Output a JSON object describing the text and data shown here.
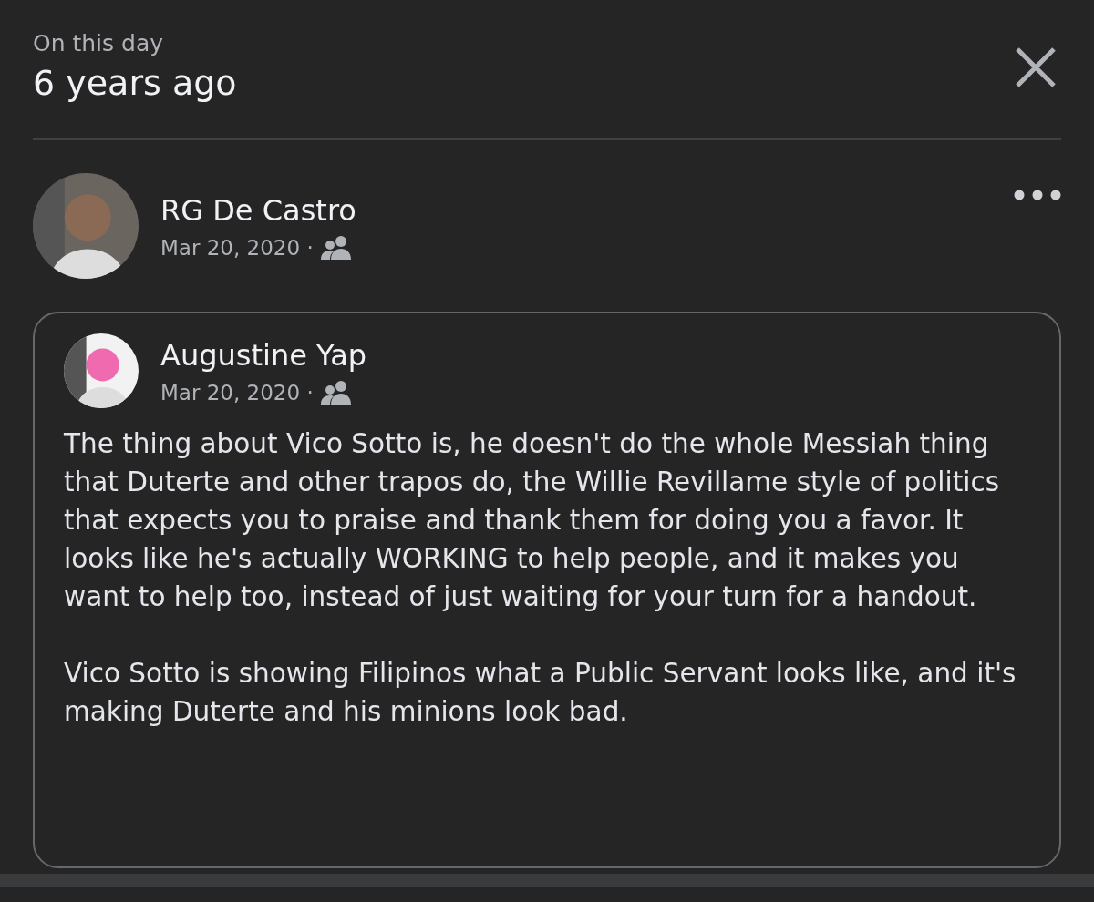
{
  "header": {
    "label": "On this day",
    "title": "6 years ago"
  },
  "post": {
    "author": "RG De Castro",
    "date": "Mar 20, 2020 ·",
    "shared": {
      "author": "Augustine Yap",
      "date": "Mar 20, 2020 ·",
      "paragraphs": [
        "The thing about Vico Sotto is, he doesn't do the whole Messiah thing that Duterte and other trapos do, the Willie Revillame style of politics that expects you to praise and thank them for doing you a favor. It looks like he's actually WORKING to help people, and it makes you want to help too, instead of just waiting for your turn for a handout.",
        "Vico Sotto is showing Filipinos what a Public Servant looks like, and it's making Duterte and his minions look bad."
      ]
    }
  }
}
